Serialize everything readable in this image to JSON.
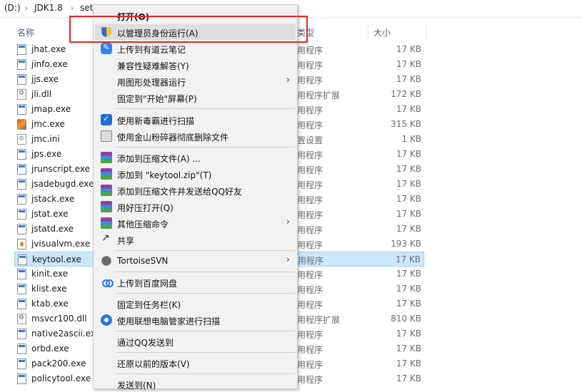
{
  "address": {
    "drive": "(D:)",
    "folder": "JDK1.8",
    "sub": "set"
  },
  "columns": {
    "name": "名称",
    "type": "类型",
    "size": "大小"
  },
  "files": [
    {
      "name": "jhat.exe",
      "type": "用程序",
      "size": "17 KB",
      "icon": "exe-icon"
    },
    {
      "name": "jinfo.exe",
      "type": "用程序",
      "size": "17 KB",
      "icon": "exe-icon"
    },
    {
      "name": "jjs.exe",
      "type": "用程序",
      "size": "17 KB",
      "icon": "exe-icon"
    },
    {
      "name": "jli.dll",
      "type": "用程序扩展",
      "size": "172 KB",
      "icon": "dll-icon"
    },
    {
      "name": "jmap.exe",
      "type": "用程序",
      "size": "17 KB",
      "icon": "exe-icon"
    },
    {
      "name": "jmc.exe",
      "type": "用程序",
      "size": "315 KB",
      "icon": "jmc-icon"
    },
    {
      "name": "jmc.ini",
      "type": "置设置",
      "size": "1 KB",
      "icon": "ini-icon"
    },
    {
      "name": "jps.exe",
      "type": "用程序",
      "size": "17 KB",
      "icon": "exe-icon"
    },
    {
      "name": "jrunscript.exe",
      "type": "用程序",
      "size": "17 KB",
      "icon": "exe-icon"
    },
    {
      "name": "jsadebugd.exe",
      "type": "用程序",
      "size": "17 KB",
      "icon": "exe-icon"
    },
    {
      "name": "jstack.exe",
      "type": "用程序",
      "size": "17 KB",
      "icon": "exe-icon"
    },
    {
      "name": "jstat.exe",
      "type": "用程序",
      "size": "17 KB",
      "icon": "exe-icon"
    },
    {
      "name": "jstatd.exe",
      "type": "用程序",
      "size": "17 KB",
      "icon": "exe-icon"
    },
    {
      "name": "jvisualvm.exe",
      "type": "用程序",
      "size": "193 KB",
      "icon": "jvisualvm-icon"
    },
    {
      "name": "keytool.exe",
      "type": "用程序",
      "size": "17 KB",
      "icon": "exe-icon",
      "selected": true
    },
    {
      "name": "kinit.exe",
      "type": "用程序",
      "size": "17 KB",
      "icon": "exe-icon"
    },
    {
      "name": "klist.exe",
      "type": "用程序",
      "size": "17 KB",
      "icon": "exe-icon"
    },
    {
      "name": "ktab.exe",
      "type": "用程序",
      "size": "17 KB",
      "icon": "exe-icon"
    },
    {
      "name": "msvcr100.dll",
      "type": "用程序扩展",
      "size": "810 KB",
      "icon": "dll-icon"
    },
    {
      "name": "native2ascii.exe",
      "type": "用程序",
      "size": "17 KB",
      "icon": "exe-icon"
    },
    {
      "name": "orbd.exe",
      "type": "用程序",
      "size": "17 KB",
      "icon": "exe-icon"
    },
    {
      "name": "pack200.exe",
      "type": "用程序",
      "size": "17 KB",
      "icon": "exe-icon"
    },
    {
      "name": "policytool.exe",
      "type": "用程序",
      "size": "17 KB",
      "icon": "exe-icon"
    }
  ],
  "menu": {
    "open": "打开(O)",
    "run_as_admin": "以管理员身份运行(A)",
    "upload_youdao": "上传到有道云笔记",
    "compat": "兼容性疑难解答(Y)",
    "gpu_run": "用图形处理器运行",
    "pin_start": "固定到\"开始\"屏幕(P)",
    "scan_xdb": "使用新毒霸进行扫描",
    "shred": "使用金山粉碎器彻底删除文件",
    "add_archive": "添加到压缩文件(A) ...",
    "add_zip": "添加到 \"keytool.zip\"(T)",
    "add_send_qq": "添加到压缩文件并发送给QQ好友",
    "open_haozip": "用好压打开(Q)",
    "other_zip": "其他压缩命令",
    "share": "共享",
    "svn": "TortoiseSVN",
    "baidu": "上传到百度网盘",
    "pin_taskbar": "固定到任务栏(K)",
    "lenovo_scan": "使用联想电脑管家进行扫描",
    "send_qq": "通过QQ发送到",
    "restore": "还原以前的版本(V)",
    "send_to": "发送到(N)"
  },
  "colors": {
    "selection": "#cce8ff",
    "annotation": "#e8262a",
    "menu_bg": "#f2f2f2"
  }
}
